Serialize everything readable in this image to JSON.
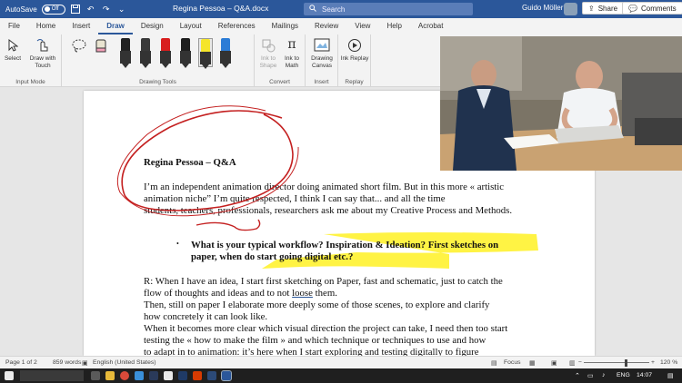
{
  "titlebar": {
    "autosave_label": "AutoSave",
    "autosave_state": "Off",
    "doc_title": "Regina Pessoa – Q&A.docx",
    "search_placeholder": "Search",
    "user_name": "Guido Möller",
    "icons": [
      "save-icon",
      "undo-icon",
      "redo-icon",
      "customize-icon"
    ]
  },
  "tabs": [
    "File",
    "Home",
    "Insert",
    "Draw",
    "Design",
    "Layout",
    "References",
    "Mailings",
    "Review",
    "View",
    "Help",
    "Acrobat"
  ],
  "active_tab": "Draw",
  "tab_actions": {
    "share": "Share",
    "comments": "Comments"
  },
  "ribbon": {
    "input_mode": {
      "label": "Input Mode",
      "select": "Select",
      "draw_with_touch": "Draw with Touch"
    },
    "drawing_tools": {
      "label": "Drawing Tools"
    },
    "convert": {
      "label": "Convert",
      "ink_to_shape": "Ink to Shape",
      "ink_to_math": "Ink to Math"
    },
    "insert": {
      "label": "Insert",
      "drawing_canvas": "Drawing Canvas"
    },
    "replay": {
      "label": "Replay",
      "ink_replay": "Ink Replay"
    },
    "pen_colors": [
      "#222222",
      "#3a3a3a",
      "#d81e1e",
      "#1e1e1e",
      "#f5e52a",
      "#2b7cd6"
    ]
  },
  "document": {
    "heading": "Regina Pessoa – Q&A",
    "para1": [
      "I’m an independent animation director doing animated short film. But in this more « artistic",
      "animation niche” I’m quite respected, I think I can say that... and all the time",
      "students, teachers, professionals, researchers ask me about my Creative Process and Methods."
    ],
    "bullet_q": [
      "What is your typical workflow? Inspiration & Ideation? First sketches on",
      "paper, when do start going digital etc.?"
    ],
    "answer": [
      "R: When I have an idea, I start first sketching on Paper, fast and schematic, just to catch the",
      "flow of thoughts and ideas and to not ",
      "loose",
      " them.",
      "Then, still on paper I elaborate more deeply some of those scenes, to explore and clarify",
      "how concretely it can look like.",
      "When it becomes more clear which visual direction the project can take, I need then too start",
      "testing the « how to make the film » and which technique or techniques to use and how",
      "to adapt in to animation: it’s here when I start exploring and testing digitally to figure"
    ]
  },
  "statusbar": {
    "page": "Page 1 of 2",
    "words": "859 words",
    "language": "English (United States)",
    "focus": "Focus",
    "zoom": "120 %"
  },
  "taskbar": {
    "language": "ENG",
    "time": "14:07"
  },
  "colors": {
    "word_blue": "#2b579a",
    "ink_red": "#c42020",
    "highlight": "#fff23a"
  }
}
